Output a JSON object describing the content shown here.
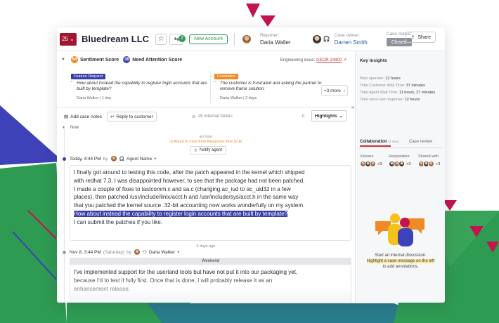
{
  "header": {
    "priority": "25",
    "company": "Bluedream LLC",
    "badge_count": "2",
    "new_account": "New Account",
    "reporter_label": "Reporter:",
    "reporter": "Daria Waller",
    "owner_label": "Case owner:",
    "owner": "Darren Smith",
    "status_label": "Case status:",
    "status": "Closed",
    "share": "Share"
  },
  "scores": {
    "sentiment_value": "54",
    "sentiment_label": "Sentiment Score",
    "attention_value": "38",
    "attention_label": "Need Attention Score",
    "eng_issue_label": "Engineering issue:",
    "eng_issue": "GEOR-24400"
  },
  "highlights": [
    {
      "tag": "Feature Request",
      "text": "How about instead the capability to register login accounts that are built by template?",
      "meta": "Daria Walker | 1 day"
    },
    {
      "tag": "Frustration",
      "text": "The customer is frustrated and asking the partner to remove frame solution.",
      "meta": "Daria Walker | 2 days"
    }
  ],
  "more_label": "+3 more",
  "toolbar": {
    "add_notes": "Add case notes",
    "reply": "Reply to customer",
    "internal": "15 Internal Notes",
    "highlights": "Highlights"
  },
  "timeline": {
    "now": "Now",
    "an_hour": "an hour",
    "warning": "About to miss First Response time SLA!",
    "notify": "Notify agent",
    "msg1_time": "Today, 4:44 PM",
    "msg1_by": "by",
    "msg1_agent": "Agent Name",
    "msg1_lines": [
      "I finally got around to testing this code, after the patch appeared in the kernel which shipped",
      "with redhat 7.3. I was disappointed however, to see that the package had not been patched.",
      "I made a couple of fixes to lastcomm.c and sa.c (changing ac_iud to ac_uid32 in a few",
      "places), then patched /usr/include/linix/acct.h and /usr/include/sys/acct.h in the same way",
      "that you patched the kernel source. 32-bit accounting now works wonderfully on my system."
    ],
    "msg1_selected": "How about instead the capability to register login accounts that are built by template?",
    "msg1_last": "I can submit the patches if you like.",
    "days_ago": "5 days ago",
    "msg2_time": "Nov 8, 3:44 PM",
    "msg2_day": "(Saturday)",
    "msg2_by": "by",
    "msg2_name": "Daria Walker",
    "weekend": "Weekend",
    "msg2_lines": [
      "I've implemented support for the userland tools but have not put it into our packaging yet,",
      "because I'd to test it fully first. Once that is done, I will probably release it as an",
      "enhancement release."
    ]
  },
  "panel": {
    "title": "Key Insights",
    "kv": [
      {
        "k": "Web operator:",
        "v": "12 hours"
      },
      {
        "k": "Total Customer Wait Time:",
        "v": "37 minutes"
      },
      {
        "k": "Total Agent Wait Time:",
        "v": "11 hours, 27 minutes"
      },
      {
        "k": "Time since last response:",
        "v": "12 hours"
      }
    ],
    "tab_collab": "Collaboration",
    "tab_collab_count": "(3 new)",
    "tab_review": "Case review",
    "viewers": "Viewers",
    "responders": "Responders",
    "shared": "Shared with",
    "plus": "+3",
    "empty1": "Start an internal discussion.",
    "empty2": "Highlight a case message on the left",
    "empty3": "to add annotations."
  }
}
